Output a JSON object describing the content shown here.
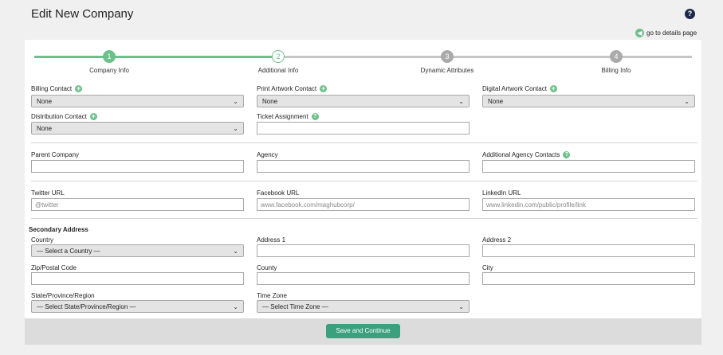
{
  "page_title": "Edit New Company",
  "go_details": "go to details page",
  "steps": [
    {
      "num": "1",
      "label": "Company Info"
    },
    {
      "num": "2",
      "label": "Additional Info"
    },
    {
      "num": "3",
      "label": "Dynamic Attributes"
    },
    {
      "num": "4",
      "label": "Billing Info"
    }
  ],
  "contacts": {
    "billing": {
      "label": "Billing Contact",
      "value": "None"
    },
    "print_artwork": {
      "label": "Print Artwork Contact",
      "value": "None"
    },
    "digital_artwork": {
      "label": "Digital Artwork Contact",
      "value": "None"
    },
    "distribution": {
      "label": "Distribution Contact",
      "value": "None"
    },
    "ticket_assignment": {
      "label": "Ticket Assignment",
      "value": ""
    }
  },
  "company": {
    "parent_label": "Parent Company",
    "agency_label": "Agency",
    "additional_agency_label": "Additional Agency Contacts"
  },
  "social": {
    "twitter_label": "Twitter URL",
    "twitter_placeholder": "@twitter",
    "facebook_label": "Facebook URL",
    "facebook_placeholder": "www.facebook.com/maghubcorp/",
    "linkedin_label": "LinkedIn URL",
    "linkedin_placeholder": "www.linkedin.com/public/profile/link"
  },
  "address": {
    "heading": "Secondary Address",
    "country_label": "Country",
    "country_value": "— Select a Country —",
    "address1_label": "Address 1",
    "address2_label": "Address 2",
    "zip_label": "Zip/Postal Code",
    "county_label": "County",
    "city_label": "City",
    "state_label": "State/Province/Region",
    "state_value": "— Select State/Province/Region —",
    "timezone_label": "Time Zone",
    "timezone_value": "— Select Time Zone —"
  },
  "save_label": "Save and Continue",
  "colors": {
    "accent": "#6cc18a",
    "button": "#3aa07e",
    "help": "#1b2a4a"
  }
}
